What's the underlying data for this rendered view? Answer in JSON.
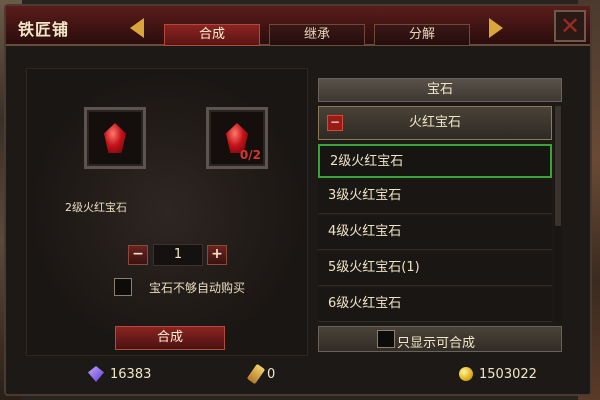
{
  "window": {
    "title": "铁匠铺"
  },
  "tabs": [
    {
      "label": "合成",
      "active": true
    },
    {
      "label": "继承",
      "active": false
    },
    {
      "label": "分解",
      "active": false
    }
  ],
  "craft": {
    "source_slot": {
      "icon": "red-gem-icon"
    },
    "target_slot": {
      "icon": "red-gem-icon",
      "count": "0/2"
    },
    "item_name": "2级火红宝石",
    "quantity": "1",
    "minus_label": "−",
    "plus_label": "+",
    "auto_buy_label": "宝石不够自动购买",
    "auto_buy_checked": false,
    "craft_button_label": "合成"
  },
  "list": {
    "header": "宝石",
    "category": "火红宝石",
    "items": [
      {
        "label": "2级火红宝石",
        "selected": true
      },
      {
        "label": "3级火红宝石",
        "selected": false
      },
      {
        "label": "4级火红宝石",
        "selected": false
      },
      {
        "label": "5级火红宝石(1)",
        "selected": false
      },
      {
        "label": "6级火红宝石",
        "selected": false
      }
    ],
    "filter_label": "只显示可合成",
    "filter_checked": false
  },
  "currency": [
    {
      "icon": "diamond-icon",
      "value": "16383"
    },
    {
      "icon": "scroll-icon",
      "value": "0"
    },
    {
      "icon": "gold-coin-icon",
      "value": "1503022"
    }
  ],
  "colors": {
    "accent_red": "#8a2421",
    "selected_green": "#3aa43a",
    "gold_arrow": "#d9a63a"
  }
}
